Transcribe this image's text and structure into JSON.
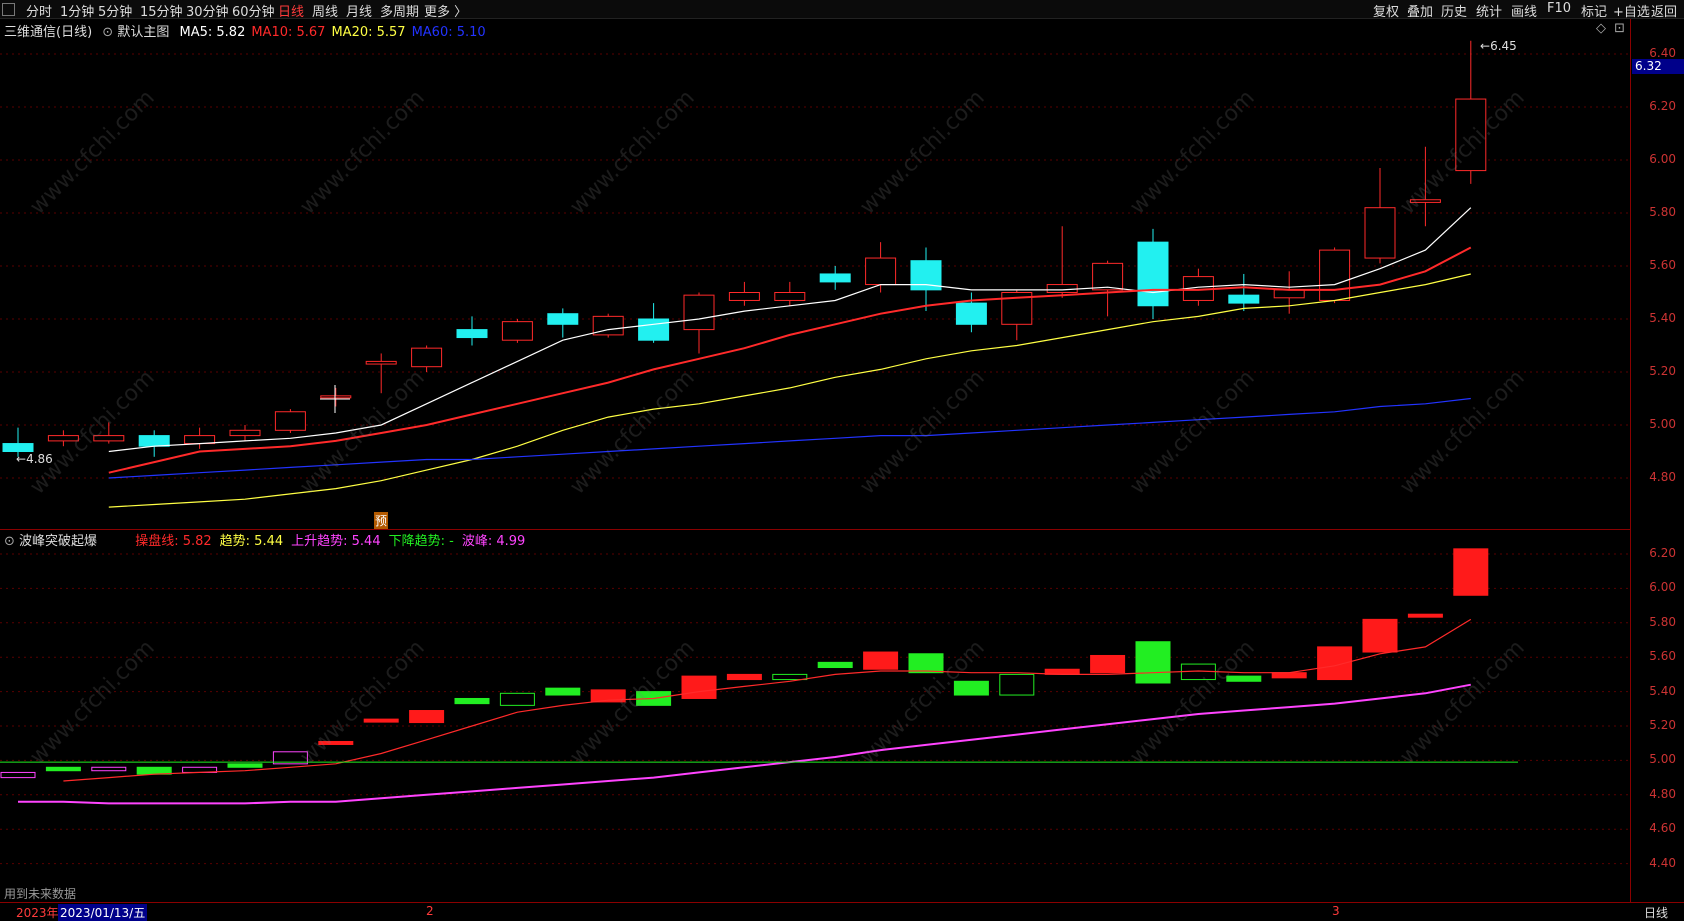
{
  "toolbar": {
    "periods": [
      "分时",
      "1分钟",
      "5分钟",
      "15分钟",
      "30分钟",
      "60分钟",
      "日线",
      "周线",
      "月线",
      "多周期",
      "更多 〉"
    ],
    "active_period": "日线",
    "right_buttons": [
      "复权",
      "叠加",
      "历史",
      "统计",
      "画线",
      "F10",
      "标记",
      "+自选",
      "返回"
    ]
  },
  "main": {
    "title": "三维通信(日线)",
    "template": "默认主图",
    "ma": [
      {
        "label": "MA5:",
        "value": "5.82",
        "color": "#ffffff"
      },
      {
        "label": "MA10:",
        "value": "5.67",
        "color": "#ff2a2a"
      },
      {
        "label": "MA20:",
        "value": "5.57",
        "color": "#ffff44"
      },
      {
        "label": "MA60:",
        "value": "5.10",
        "color": "#2233ff"
      }
    ],
    "y_ticks": [
      "6.40",
      "6.20",
      "6.00",
      "5.80",
      "5.60",
      "5.40",
      "5.20",
      "5.00",
      "4.80"
    ],
    "current_price": "6.32",
    "high_marker": "6.45",
    "low_marker": "4.86",
    "yu_badge": "预"
  },
  "sub": {
    "title": "波峰突破起爆",
    "indicators": [
      {
        "label": "操盘线:",
        "value": "5.82",
        "color": "#ff2a2a"
      },
      {
        "label": "趋势:",
        "value": "5.44",
        "color": "#ffff44"
      },
      {
        "label": "上升趋势:",
        "value": "5.44",
        "color": "#ff44ff"
      },
      {
        "label": "下降趋势:",
        "value": "-",
        "color": "#22ee22"
      },
      {
        "label": "波峰:",
        "value": "4.99",
        "color": "#ff44ff"
      }
    ],
    "y_ticks": [
      "6.20",
      "6.00",
      "5.80",
      "5.60",
      "5.40",
      "5.20",
      "5.00",
      "4.80",
      "4.60",
      "4.40"
    ],
    "footnote": "用到未来数据"
  },
  "bottom": {
    "year": "2023年",
    "date": "2023/01/13/五",
    "month_labels": [
      "2",
      "3"
    ],
    "period": "日线"
  },
  "watermark": "www.cfchi.com",
  "chart_data": {
    "type": "candlestick",
    "ma_lines": {
      "MA5": [
        4.9,
        4.92,
        4.93,
        4.94,
        4.95,
        4.97,
        5.0,
        5.08,
        5.16,
        5.24,
        5.32,
        5.36,
        5.38,
        5.4,
        5.43,
        5.45,
        5.47,
        5.53,
        5.53,
        5.51,
        5.51,
        5.51,
        5.52,
        5.5,
        5.52,
        5.53,
        5.52,
        5.53,
        5.59,
        5.66,
        5.82
      ],
      "MA10": [
        4.82,
        4.86,
        4.9,
        4.91,
        4.92,
        4.94,
        4.97,
        5.0,
        5.04,
        5.08,
        5.12,
        5.16,
        5.21,
        5.25,
        5.29,
        5.34,
        5.38,
        5.42,
        5.45,
        5.47,
        5.48,
        5.49,
        5.5,
        5.51,
        5.51,
        5.52,
        5.51,
        5.51,
        5.53,
        5.58,
        5.67
      ],
      "MA20": [
        4.69,
        4.7,
        4.71,
        4.72,
        4.74,
        4.76,
        4.79,
        4.83,
        4.87,
        4.92,
        4.98,
        5.03,
        5.06,
        5.08,
        5.11,
        5.14,
        5.18,
        5.21,
        5.25,
        5.28,
        5.3,
        5.33,
        5.36,
        5.39,
        5.41,
        5.44,
        5.45,
        5.47,
        5.5,
        5.53,
        5.57
      ],
      "MA60": [
        4.8,
        4.81,
        4.82,
        4.83,
        4.84,
        4.85,
        4.86,
        4.87,
        4.87,
        4.88,
        4.89,
        4.9,
        4.91,
        4.92,
        4.93,
        4.94,
        4.95,
        4.96,
        4.96,
        4.97,
        4.98,
        4.99,
        5.0,
        5.01,
        5.02,
        5.03,
        5.04,
        5.05,
        5.07,
        5.08,
        5.1
      ]
    },
    "candles": [
      {
        "o": 4.93,
        "c": 4.9,
        "h": 4.99,
        "l": 4.88
      },
      {
        "o": 4.94,
        "c": 4.96,
        "h": 4.98,
        "l": 4.92
      },
      {
        "o": 4.94,
        "c": 4.96,
        "h": 5.01,
        "l": 4.93
      },
      {
        "o": 4.96,
        "c": 4.92,
        "h": 4.98,
        "l": 4.88
      },
      {
        "o": 4.93,
        "c": 4.96,
        "h": 4.99,
        "l": 4.91
      },
      {
        "o": 4.96,
        "c": 4.98,
        "h": 5.0,
        "l": 4.94
      },
      {
        "o": 4.98,
        "c": 5.05,
        "h": 5.06,
        "l": 4.97
      },
      {
        "o": 5.11,
        "c": 5.11,
        "h": 5.14,
        "l": 5.07
      },
      {
        "o": 5.23,
        "c": 5.24,
        "h": 5.27,
        "l": 5.12
      },
      {
        "o": 5.22,
        "c": 5.29,
        "h": 5.3,
        "l": 5.2
      },
      {
        "o": 5.36,
        "c": 5.33,
        "h": 5.41,
        "l": 5.3
      },
      {
        "o": 5.32,
        "c": 5.39,
        "h": 5.4,
        "l": 5.31
      },
      {
        "o": 5.42,
        "c": 5.38,
        "h": 5.44,
        "l": 5.33
      },
      {
        "o": 5.34,
        "c": 5.41,
        "h": 5.42,
        "l": 5.33
      },
      {
        "o": 5.4,
        "c": 5.32,
        "h": 5.46,
        "l": 5.31
      },
      {
        "o": 5.36,
        "c": 5.49,
        "h": 5.5,
        "l": 5.27
      },
      {
        "o": 5.47,
        "c": 5.5,
        "h": 5.54,
        "l": 5.45
      },
      {
        "o": 5.47,
        "c": 5.5,
        "h": 5.54,
        "l": 5.45
      },
      {
        "o": 5.57,
        "c": 5.54,
        "h": 5.6,
        "l": 5.51
      },
      {
        "o": 5.53,
        "c": 5.63,
        "h": 5.69,
        "l": 5.5
      },
      {
        "o": 5.62,
        "c": 5.51,
        "h": 5.67,
        "l": 5.43
      },
      {
        "o": 5.46,
        "c": 5.38,
        "h": 5.5,
        "l": 5.35
      },
      {
        "o": 5.38,
        "c": 5.5,
        "h": 5.51,
        "l": 5.32
      },
      {
        "o": 5.5,
        "c": 5.53,
        "h": 5.75,
        "l": 5.48
      },
      {
        "o": 5.51,
        "c": 5.61,
        "h": 5.62,
        "l": 5.41
      },
      {
        "o": 5.69,
        "c": 5.45,
        "h": 5.74,
        "l": 5.4
      },
      {
        "o": 5.47,
        "c": 5.56,
        "h": 5.59,
        "l": 5.45
      },
      {
        "o": 5.49,
        "c": 5.46,
        "h": 5.57,
        "l": 5.43
      },
      {
        "o": 5.48,
        "c": 5.51,
        "h": 5.58,
        "l": 5.42
      },
      {
        "o": 5.47,
        "c": 5.66,
        "h": 5.67,
        "l": 5.46
      },
      {
        "o": 5.63,
        "c": 5.82,
        "h": 5.97,
        "l": 5.61
      },
      {
        "o": 5.84,
        "c": 5.85,
        "h": 6.05,
        "l": 5.75
      },
      {
        "o": 5.96,
        "c": 6.23,
        "h": 6.45,
        "l": 5.91
      }
    ],
    "sub_lines": {
      "操盘线": [
        4.88,
        4.9,
        4.92,
        4.93,
        4.94,
        4.96,
        4.98,
        5.04,
        5.12,
        5.2,
        5.28,
        5.32,
        5.35,
        5.36,
        5.4,
        5.43,
        5.46,
        5.5,
        5.52,
        5.52,
        5.51,
        5.51,
        5.5,
        5.5,
        5.51,
        5.52,
        5.51,
        5.51,
        5.55,
        5.62,
        5.66,
        5.82
      ],
      "上升趋势": [
        4.76,
        4.76,
        4.75,
        4.75,
        4.75,
        4.75,
        4.76,
        4.76,
        4.78,
        4.8,
        4.82,
        4.84,
        4.86,
        4.88,
        4.9,
        4.93,
        4.96,
        4.99,
        5.02,
        5.06,
        5.09,
        5.12,
        5.15,
        5.18,
        5.21,
        5.24,
        5.27,
        5.29,
        5.31,
        5.33,
        5.36,
        5.39,
        5.44
      ],
      "波峰": 4.99
    }
  }
}
